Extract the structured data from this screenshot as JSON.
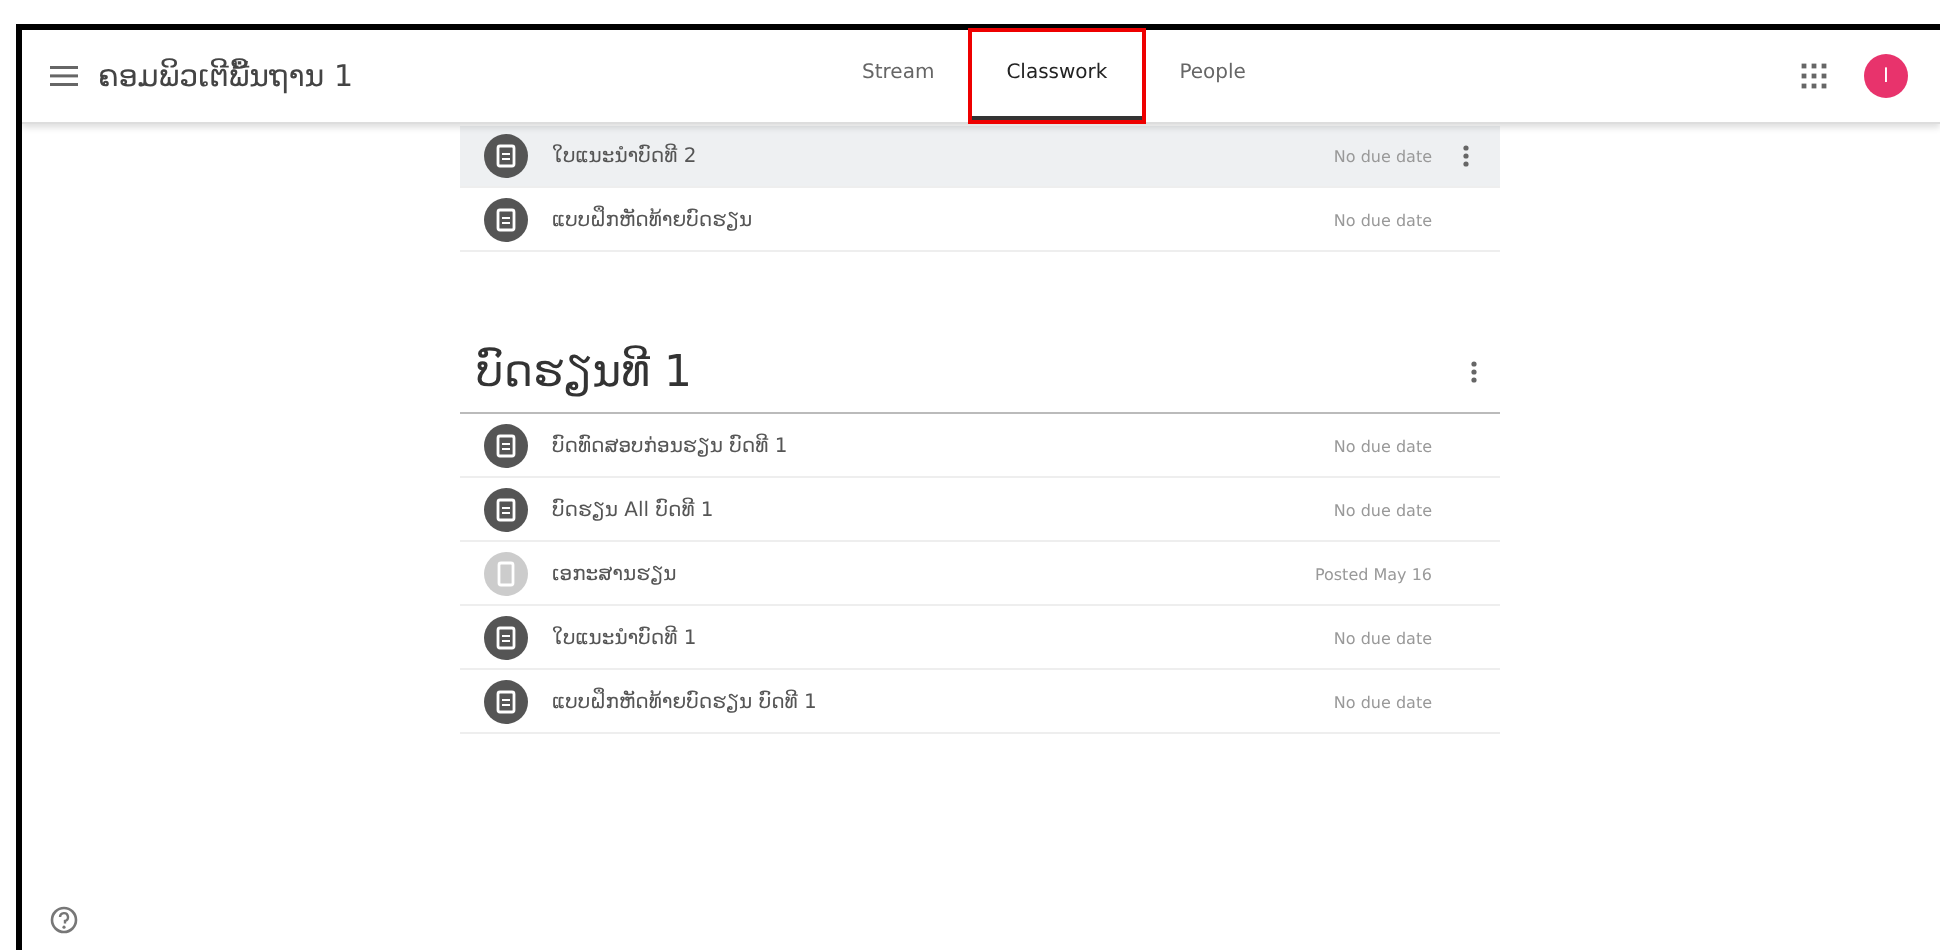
{
  "header": {
    "title": "ຄອມພິວເຕີພື້ນຖານ 1",
    "tabs": [
      {
        "label": "Stream",
        "selected": false
      },
      {
        "label": "Classwork",
        "selected": true,
        "highlighted": true
      },
      {
        "label": "People",
        "selected": false
      }
    ],
    "avatar": "I"
  },
  "top_items": [
    {
      "kind": "assignment",
      "title": "ໃບແນະນຳບົດທີ 2",
      "due": "No due date",
      "selected": true
    },
    {
      "kind": "assignment",
      "title": "ແບບຝຶກຫັດທ້າຍບົດຮຽນ",
      "due": "No due date",
      "selected": false
    }
  ],
  "topic": {
    "title": "ບົດຮຽນທີ 1",
    "items": [
      {
        "kind": "assignment",
        "title": "ບົດທົດສອບກ່ອນຮຽນ ບົດທີ 1",
        "due": "No due date",
        "selected": false
      },
      {
        "kind": "assignment",
        "title": "ບົດຮຽນ All ບົດທີ 1",
        "due": "No due date",
        "selected": false
      },
      {
        "kind": "material",
        "title": "ເອກະສານຮຽນ",
        "due": "Posted May 16",
        "selected": false
      },
      {
        "kind": "assignment",
        "title": "ໃບແນະນຳບົດທີ 1",
        "due": "No due date",
        "selected": false
      },
      {
        "kind": "assignment",
        "title": "ແບບຝຶກຫັດທ້າຍບົດຮຽນ ບົດທີ 1",
        "due": "No due date",
        "selected": false
      }
    ]
  }
}
